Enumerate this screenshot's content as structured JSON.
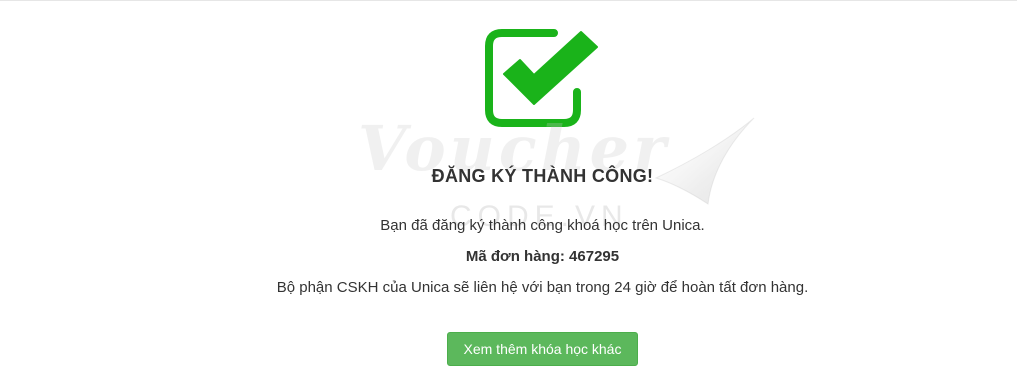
{
  "success": {
    "icon": "checkbox-check-icon",
    "title": "ĐĂNG KÝ THÀNH CÔNG!",
    "message": "Bạn đã đăng ký thành công khoá học trên Unica.",
    "order_label": "Mã đơn hàng: 467295",
    "contact_note": "Bộ phận CSKH của Unica sẽ liên hệ với bạn trong 24 giờ để hoàn tất đơn hàng.",
    "button_label": "Xem thêm khóa học khác"
  },
  "watermark": {
    "main": "Voucher",
    "sub": "CODE.VN"
  },
  "colors": {
    "icon_green": "#1ab31a",
    "button_green": "#5cb85c",
    "text": "#333333"
  }
}
